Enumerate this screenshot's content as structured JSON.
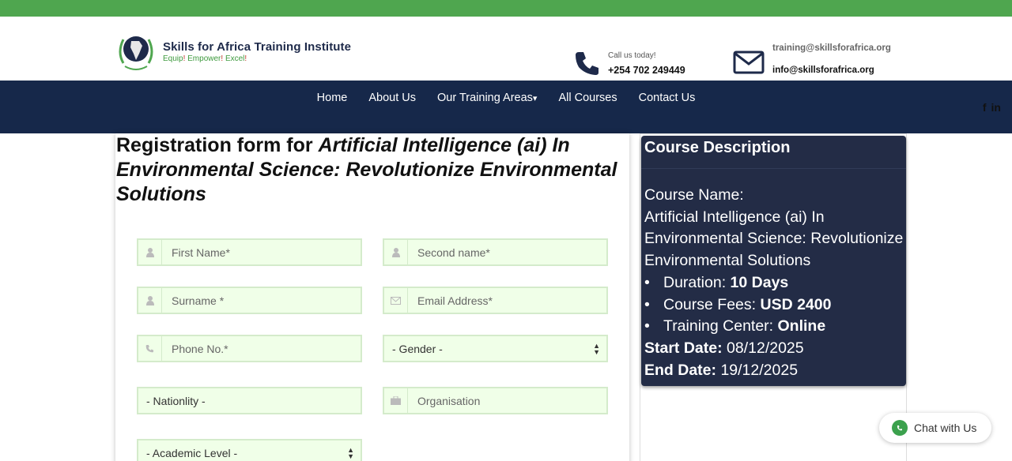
{
  "header": {
    "logo_title": "Skills for Africa Training Institute",
    "logo_tag_1": "Equip",
    "logo_tag_2": "Empower",
    "logo_tag_3": "Excel",
    "call_label": "Call us today!",
    "call_number": "+254 702 249449",
    "email_1": "training@skillsforafrica.org",
    "email_2": "info@skillsforafrica.org",
    "icons": [
      "phone-icon",
      "mail-icon"
    ]
  },
  "nav": {
    "items": [
      "Home",
      "About Us",
      "Our Training Areas",
      "All Courses",
      "Contact Us"
    ],
    "dropdown_marker": "▾",
    "social": [
      "f",
      "in"
    ]
  },
  "form": {
    "title_prefix": "Registration form for",
    "title_course": "Artificial Intelligence (ai) In Environmental Science: Revolutionize Environmental Solutions",
    "fields": {
      "first_name": "First Name*",
      "second_name": "Second name*",
      "surname": "Surname *",
      "email": "Email Address*",
      "phone": "Phone No.*",
      "gender": "- Gender -",
      "nationality": "- Nationlity -",
      "organisation": "Organisation",
      "academic_level": "- Academic Level -"
    }
  },
  "description": {
    "heading": "Course Description",
    "course_name_label": "Course Name:",
    "course_name": "Artificial Intelligence (ai) In Environmental Science: Revolutionize Environmental Solutions",
    "duration_label": "Duration:",
    "duration": "10 Days",
    "fees_label": "Course Fees:",
    "fees": "USD 2400",
    "center_label": "Training Center:",
    "center": "Online",
    "start_label": "Start Date:",
    "start": "08/12/2025",
    "end_label": "End Date:",
    "end": "19/12/2025"
  },
  "chat": {
    "label": "Chat with Us"
  },
  "colors": {
    "topbar": "#4fa64f",
    "nav": "#16284a",
    "desc_bg": "#232c46",
    "field_bg": "#f0ffe8"
  }
}
